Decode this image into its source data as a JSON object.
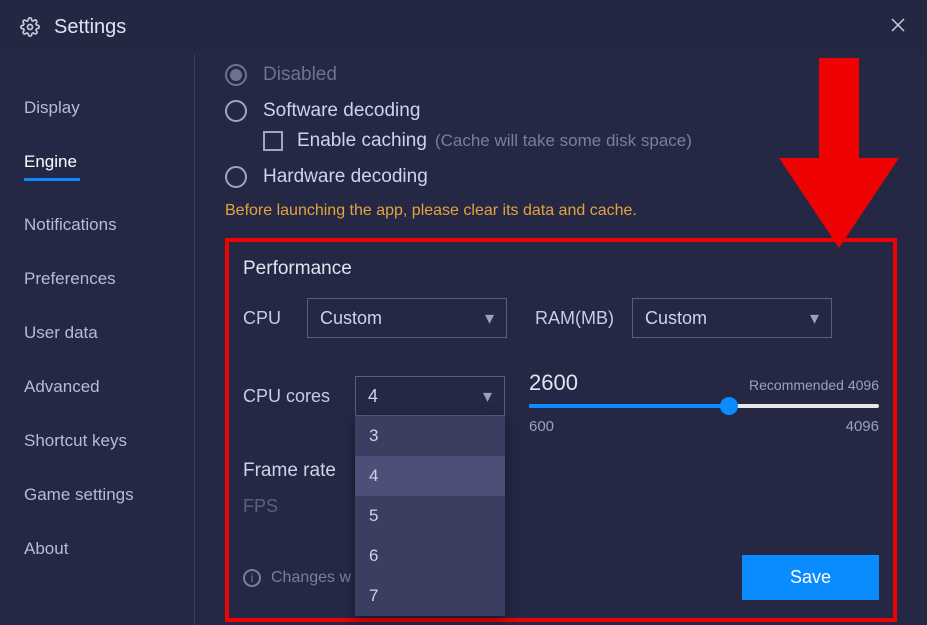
{
  "header": {
    "title": "Settings"
  },
  "sidebar": {
    "items": [
      {
        "label": "Display"
      },
      {
        "label": "Engine"
      },
      {
        "label": "Notifications"
      },
      {
        "label": "Preferences"
      },
      {
        "label": "User data"
      },
      {
        "label": "Advanced"
      },
      {
        "label": "Shortcut keys"
      },
      {
        "label": "Game settings"
      },
      {
        "label": "About"
      }
    ],
    "active_index": 1
  },
  "decoding": {
    "options": {
      "disabled": "Disabled",
      "software": "Software decoding",
      "hardware": "Hardware decoding"
    },
    "caching": {
      "label": "Enable caching",
      "hint": "(Cache will take some disk space)"
    },
    "warning": "Before launching the app, please clear its data and cache."
  },
  "performance": {
    "title": "Performance",
    "cpu": {
      "label": "CPU",
      "value": "Custom"
    },
    "ram": {
      "label": "RAM(MB)",
      "value": "Custom"
    },
    "cpu_cores": {
      "label": "CPU cores",
      "value": "4",
      "options": [
        "3",
        "4",
        "5",
        "6",
        "7"
      ]
    },
    "slider": {
      "current": "2600",
      "recommended": "Recommended 4096",
      "min": "600",
      "max": "4096"
    },
    "framerate": {
      "title": "Frame rate",
      "fps_label": "FPS"
    },
    "note": "Changes w                              unch",
    "save": "Save"
  }
}
